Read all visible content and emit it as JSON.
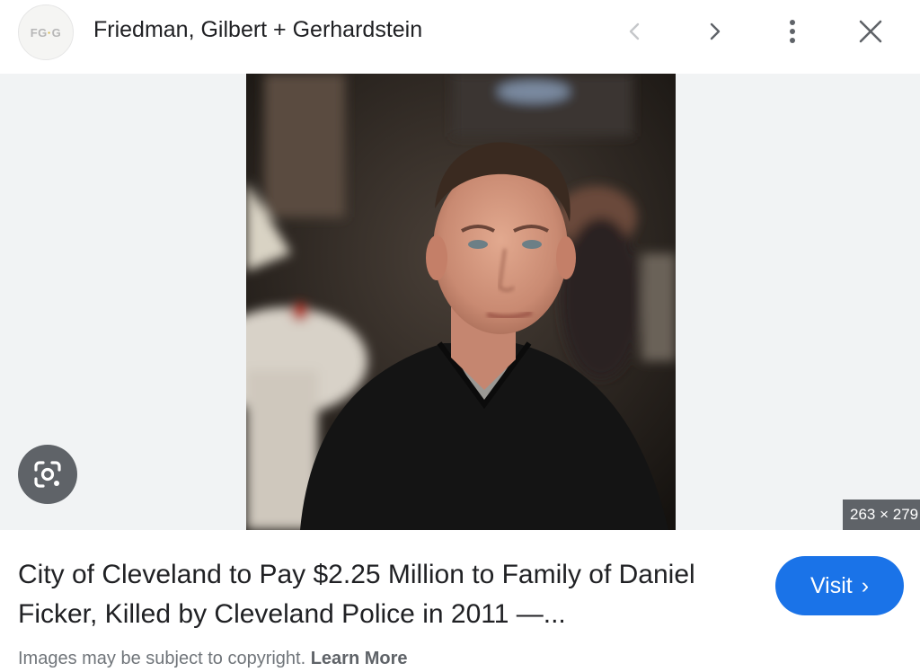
{
  "header": {
    "logo_text_left": "FG",
    "logo_text_dot": "·",
    "logo_text_right": "G",
    "source_title": "Friedman, Gilbert + Gerhardstein",
    "icons": [
      "chevron-left-icon",
      "chevron-right-icon",
      "more-vert-icon",
      "close-icon"
    ]
  },
  "image": {
    "dimensions": "263 × 279",
    "lens_icon": "google-lens-icon"
  },
  "result": {
    "caption": "City of Cleveland to Pay $2.25 Million to Family of Daniel Ficker, Killed by Cleveland Police in 2011 —...",
    "visit_label": "Visit",
    "visit_chevron": "›"
  },
  "footer": {
    "copyright_text": "Images may be subject to copyright.",
    "learn_more": "Learn More"
  },
  "colors": {
    "accent": "#1a73e8",
    "image_background": "#f1f3f4",
    "icon_gray": "#5f6368"
  }
}
